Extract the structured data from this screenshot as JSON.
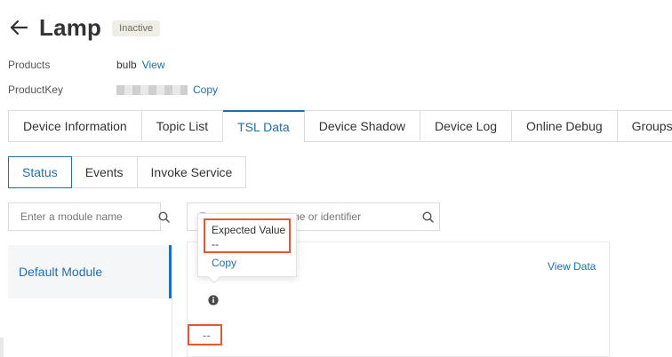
{
  "header": {
    "title": "Lamp",
    "status": "Inactive"
  },
  "meta": {
    "products_label": "Products",
    "products_value": "bulb",
    "products_link": "View",
    "productkey_label": "ProductKey",
    "productkey_copy": "Copy"
  },
  "tabs": [
    {
      "label": "Device Information"
    },
    {
      "label": "Topic List"
    },
    {
      "label": "TSL Data"
    },
    {
      "label": "Device Shadow"
    },
    {
      "label": "Device Log"
    },
    {
      "label": "Online Debug"
    },
    {
      "label": "Groups"
    }
  ],
  "active_tab": "TSL Data",
  "subtabs": [
    {
      "label": "Status"
    },
    {
      "label": "Events"
    },
    {
      "label": "Invoke Service"
    }
  ],
  "active_subtab": "Status",
  "module_search": {
    "placeholder": "Enter a module name"
  },
  "property_search": {
    "placeholder": "Enter a property name or identifier"
  },
  "modules": [
    {
      "label": "Default Module"
    }
  ],
  "card": {
    "view_data": "View Data",
    "value": "--"
  },
  "popover": {
    "title": "Expected Value",
    "value": "--",
    "copy": "Copy"
  },
  "colors": {
    "accent": "#1f6fb2",
    "highlight": "#e8572f"
  },
  "icons": {
    "back": "arrow-left-icon",
    "search": "search-icon",
    "info": "info-icon"
  }
}
